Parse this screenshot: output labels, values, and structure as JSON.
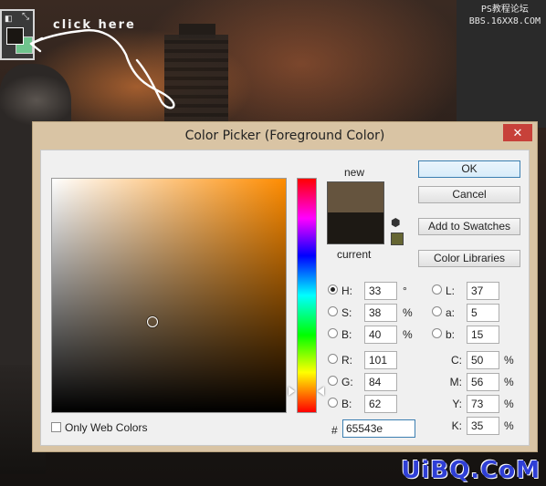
{
  "tutorial": {
    "click_here": "click here",
    "watermark_line1": "PS教程论坛",
    "watermark_line2": "BBS.16XX8.COM",
    "watermark_bottom": "UiBQ.CoM"
  },
  "tool_box": {
    "default_icon": "default-colors-icon",
    "swap_icon": "swap-arrow-icon",
    "foreground_color": "#1a1612",
    "background_color": "#6fc48d"
  },
  "dialog": {
    "title": "Color Picker (Foreground Color)",
    "close_label": "✕",
    "new_label": "new",
    "current_label": "current",
    "new_color": "#65543e",
    "current_color": "#1d1914",
    "buttons": {
      "ok": "OK",
      "cancel": "Cancel",
      "add_to_swatches": "Add to Swatches",
      "color_libraries": "Color Libraries"
    },
    "hsb": [
      {
        "label": "H:",
        "value": "33",
        "unit": "°",
        "selected": true
      },
      {
        "label": "S:",
        "value": "38",
        "unit": "%",
        "selected": false
      },
      {
        "label": "B:",
        "value": "40",
        "unit": "%",
        "selected": false
      }
    ],
    "rgb": [
      {
        "label": "R:",
        "value": "101"
      },
      {
        "label": "G:",
        "value": "84"
      },
      {
        "label": "B:",
        "value": "62"
      }
    ],
    "lab": [
      {
        "label": "L:",
        "value": "37"
      },
      {
        "label": "a:",
        "value": "5"
      },
      {
        "label": "b:",
        "value": "15"
      }
    ],
    "cmyk": [
      {
        "label": "C:",
        "value": "50",
        "unit": "%"
      },
      {
        "label": "M:",
        "value": "56",
        "unit": "%"
      },
      {
        "label": "Y:",
        "value": "73",
        "unit": "%"
      },
      {
        "label": "K:",
        "value": "35",
        "unit": "%"
      }
    ],
    "only_web_colors": "Only Web Colors",
    "hex_symbol": "#",
    "hex_value": "65543e",
    "icons": {
      "gamut_warning": "cube-icon",
      "websafe_chip": "web-safe-swatch"
    }
  }
}
